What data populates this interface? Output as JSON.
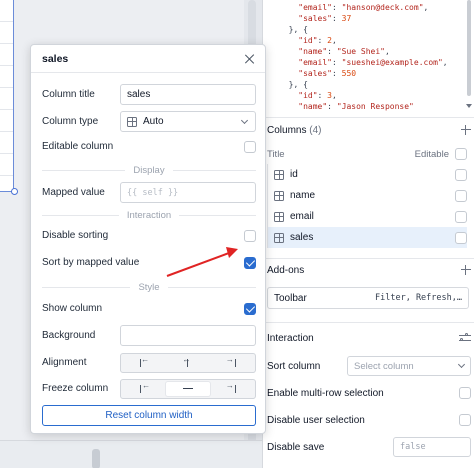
{
  "code_lines": [
    [
      {
        "t": "\"email\"",
        "c": "key"
      },
      {
        "t": ": ",
        "c": "p"
      },
      {
        "t": "\"hanson@deck.com\"",
        "c": "str"
      },
      {
        "t": ",",
        "c": "p"
      }
    ],
    [
      {
        "t": "\"sales\"",
        "c": "key"
      },
      {
        "t": ": ",
        "c": "p"
      },
      {
        "t": "37",
        "c": "num"
      }
    ],
    [
      {
        "t": "}, {",
        "c": "p"
      }
    ],
    [
      {
        "t": "\"id\"",
        "c": "key"
      },
      {
        "t": ": ",
        "c": "p"
      },
      {
        "t": "2",
        "c": "num"
      },
      {
        "t": ",",
        "c": "p"
      }
    ],
    [
      {
        "t": "\"name\"",
        "c": "key"
      },
      {
        "t": ": ",
        "c": "p"
      },
      {
        "t": "\"Sue Shei\"",
        "c": "str"
      },
      {
        "t": ",",
        "c": "p"
      }
    ],
    [
      {
        "t": "\"email\"",
        "c": "key"
      },
      {
        "t": ": ",
        "c": "p"
      },
      {
        "t": "\"sueshei@example.com\"",
        "c": "str"
      },
      {
        "t": ",",
        "c": "p"
      }
    ],
    [
      {
        "t": "\"sales\"",
        "c": "key"
      },
      {
        "t": ": ",
        "c": "p"
      },
      {
        "t": "550",
        "c": "num"
      }
    ],
    [
      {
        "t": "}, {",
        "c": "p"
      }
    ],
    [
      {
        "t": "\"id\"",
        "c": "key"
      },
      {
        "t": ": ",
        "c": "p"
      },
      {
        "t": "3",
        "c": "num"
      },
      {
        "t": ",",
        "c": "p"
      }
    ],
    [
      {
        "t": "\"name\"",
        "c": "key"
      },
      {
        "t": ": ",
        "c": "p"
      },
      {
        "t": "\"Jason Response\"",
        "c": "str"
      }
    ]
  ],
  "columns_section": {
    "title": "Columns",
    "count": "(4)",
    "header_title": "Title",
    "header_editable": "Editable",
    "items": [
      {
        "label": "id"
      },
      {
        "label": "name"
      },
      {
        "label": "email"
      },
      {
        "label": "sales"
      }
    ]
  },
  "addons_section": {
    "title": "Add-ons",
    "toolbar_name": "Toolbar",
    "toolbar_value": "Filter, Refresh,…"
  },
  "interaction_section": {
    "title": "Interaction",
    "sort_label": "Sort column",
    "sort_placeholder": "Select column",
    "multirow_label": "Enable multi-row selection",
    "disable_user_sel_label": "Disable user selection",
    "disable_save_label": "Disable save",
    "disable_save_value": "false"
  },
  "modal": {
    "title": "sales",
    "column_title_label": "Column title",
    "column_title_value": "sales",
    "column_type_label": "Column type",
    "column_type_value": "Auto",
    "editable_label": "Editable column",
    "display_sep": "Display",
    "mapped_value_label": "Mapped value",
    "mapped_value_placeholder": "{{ self }}",
    "interaction_sep": "Interaction",
    "disable_sorting_label": "Disable sorting",
    "sort_by_mapped_label": "Sort by mapped value",
    "style_sep": "Style",
    "show_column_label": "Show column",
    "background_label": "Background",
    "alignment_label": "Alignment",
    "freeze_label": "Freeze column",
    "reset_button": "Reset column width"
  },
  "colors": {
    "accent": "#2a6ccf",
    "annotation_arrow": "#e02424"
  }
}
